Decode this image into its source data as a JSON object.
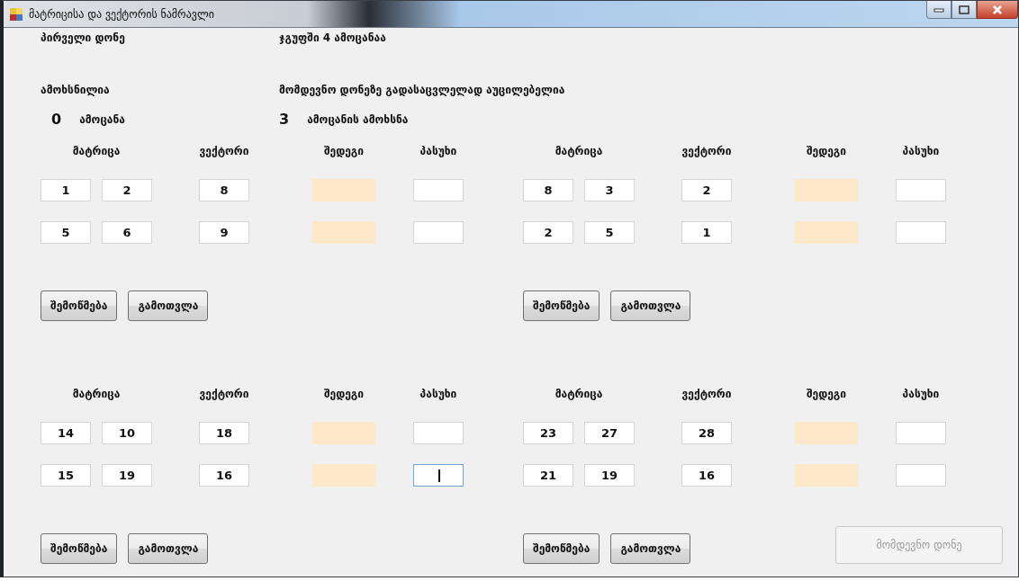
{
  "window": {
    "title": "მატრიცისა და ვექტორის ნამრავლი"
  },
  "info": {
    "level": "პირველი დონე",
    "group": "ჯგუფში 4 ამოცანაა",
    "solved_label": "ამოხსნილია",
    "solved_count": "0",
    "solved_unit": "ამოცანა",
    "required_label": "მომდევნო დონეზე გადასაცვლელად აუცილებელია",
    "required_count": "3",
    "required_unit": "ამოცანის ამოხსნა"
  },
  "tasks": [
    {
      "headers": [
        "მატრიცა",
        "ვექტორი",
        "შედეგი",
        "პასუხი"
      ],
      "rows": [
        {
          "matrix": [
            "1",
            "2"
          ],
          "vector": "8",
          "answer_focused": false
        },
        {
          "matrix": [
            "5",
            "6"
          ],
          "vector": "9",
          "answer_focused": false
        }
      ],
      "buttons": [
        "შემოწმება",
        "გამოთვლა"
      ]
    },
    {
      "headers": [
        "მატრიცა",
        "ვექტორი",
        "შედეგი",
        "პასუხი"
      ],
      "rows": [
        {
          "matrix": [
            "8",
            "3"
          ],
          "vector": "2",
          "answer_focused": false
        },
        {
          "matrix": [
            "2",
            "5"
          ],
          "vector": "1",
          "answer_focused": false
        }
      ],
      "buttons": [
        "შემოწმება",
        "გამოთვლა"
      ]
    },
    {
      "headers": [
        "მატრიცა",
        "ვექტორი",
        "შედეგი",
        "პასუხი"
      ],
      "rows": [
        {
          "matrix": [
            "14",
            "10"
          ],
          "vector": "18",
          "answer_focused": false
        },
        {
          "matrix": [
            "15",
            "19"
          ],
          "vector": "16",
          "answer_focused": true
        }
      ],
      "buttons": [
        "შემოწმება",
        "გამოთვლა"
      ]
    },
    {
      "headers": [
        "მატრიცა",
        "ვექტორი",
        "შედეგი",
        "პასუხი"
      ],
      "rows": [
        {
          "matrix": [
            "23",
            "27"
          ],
          "vector": "28",
          "answer_focused": false
        },
        {
          "matrix": [
            "21",
            "19"
          ],
          "vector": "16",
          "answer_focused": false
        }
      ],
      "buttons": [
        "შემოწმება",
        "გამოთვლა"
      ]
    }
  ],
  "next_button": {
    "label": "მომდევნო დონე",
    "disabled": true
  }
}
